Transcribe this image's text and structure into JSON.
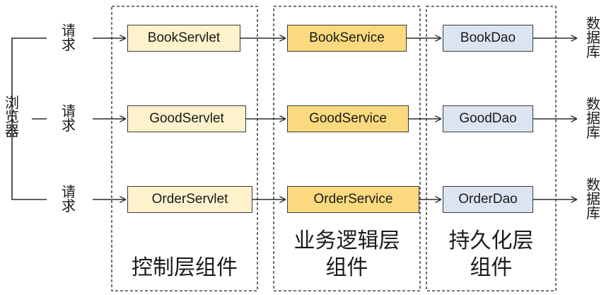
{
  "client": {
    "label_chars": [
      "浏",
      "览",
      "器"
    ]
  },
  "request": {
    "label_chars": [
      "请",
      "求"
    ]
  },
  "database": {
    "label_chars": [
      "数",
      "据",
      "库"
    ]
  },
  "layers": {
    "control": {
      "title": "控制层组件"
    },
    "service": {
      "title_line1": "业务逻辑层",
      "title_line2": "组件"
    },
    "persistence": {
      "title_line1": "持久化层",
      "title_line2": "组件"
    }
  },
  "rows": [
    {
      "servlet": "BookServlet",
      "service": "BookService",
      "dao": "BookDao"
    },
    {
      "servlet": "GoodServlet",
      "service": "GoodService",
      "dao": "GoodDao"
    },
    {
      "servlet": "OrderServlet",
      "service": "OrderService",
      "dao": "OrderDao"
    }
  ],
  "colors": {
    "servlet_fill": "#fdf2cc",
    "service_fill": "#fbd97e",
    "dao_fill": "#dce3f1",
    "line": "#2b2b2b"
  }
}
